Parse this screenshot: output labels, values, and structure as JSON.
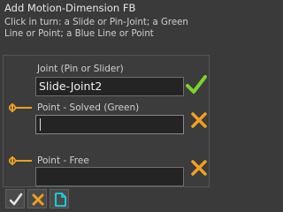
{
  "dialog": {
    "title": "Add Motion-Dimension FB",
    "instructions": "Click in turn: a Slide or Pin-Joint; a Green Line or Point; a Blue Line or Point"
  },
  "fields": [
    {
      "label": "Joint (Pin or Slider)",
      "value": "Slide-Joint2",
      "status": "accepted"
    },
    {
      "label": "Point - Solved (Green)",
      "value": "",
      "status": "pending"
    },
    {
      "label": "Point - Free",
      "value": "",
      "status": "pending"
    }
  ],
  "colors": {
    "accent_orange": "#f0a020",
    "check_green": "#7bd32a",
    "doc_cyan": "#19d6e6"
  },
  "icons": {
    "point_link": "point-link-icon",
    "accept": "checkmark-icon",
    "clear": "x-icon",
    "new_doc": "document-icon"
  }
}
